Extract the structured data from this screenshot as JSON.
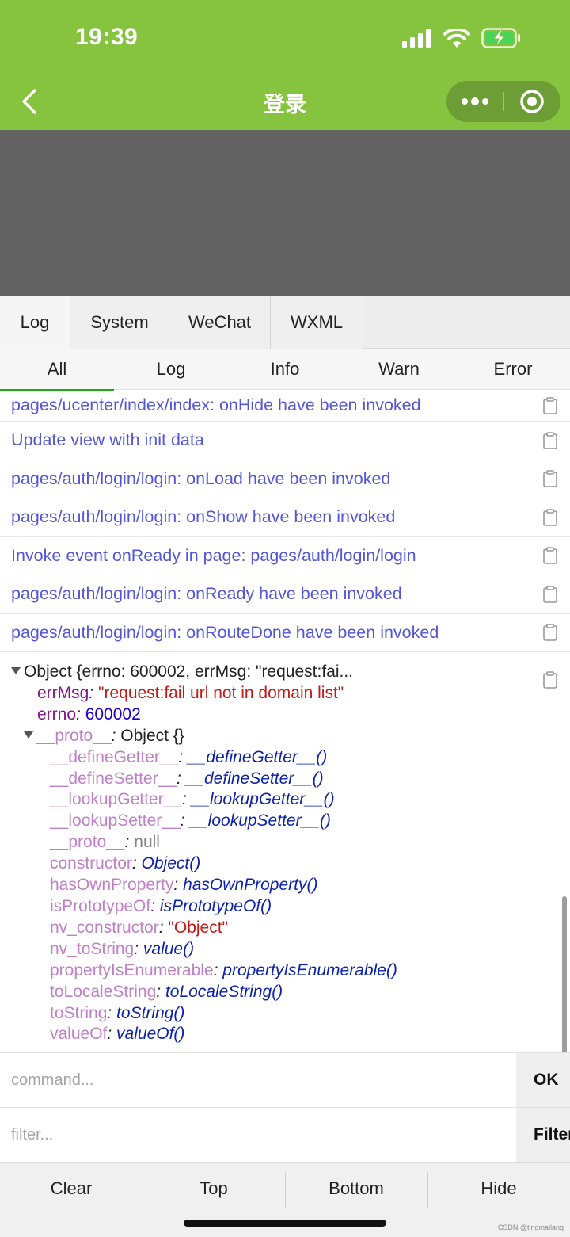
{
  "status_bar": {
    "time": "19:39"
  },
  "nav_bar": {
    "title": "登录"
  },
  "tabs": [
    {
      "label": "Log",
      "active": true
    },
    {
      "label": "System",
      "active": false
    },
    {
      "label": "WeChat",
      "active": false
    },
    {
      "label": "WXML",
      "active": false
    }
  ],
  "subtabs": [
    {
      "label": "All",
      "active": true
    },
    {
      "label": "Log",
      "active": false
    },
    {
      "label": "Info",
      "active": false
    },
    {
      "label": "Warn",
      "active": false
    },
    {
      "label": "Error",
      "active": false
    }
  ],
  "logs": [
    "pages/ucenter/index/index: onHide have been invoked",
    "Update view with init data",
    "pages/auth/login/login: onLoad have been invoked",
    "pages/auth/login/login: onShow have been invoked",
    "Invoke event onReady in page: pages/auth/login/login",
    "pages/auth/login/login: onReady have been invoked",
    "pages/auth/login/login: onRouteDone have been invoked"
  ],
  "object_entry": {
    "summary": "Object {errno: 600002, errMsg: \"request:fai...",
    "own_props": [
      {
        "key": "errMsg",
        "value": "\"request:fail url not in domain list\"",
        "type": "str"
      },
      {
        "key": "errno",
        "value": "600002",
        "type": "num"
      }
    ],
    "proto": {
      "key": "__proto__",
      "value": "Object {}"
    },
    "proto_props": [
      {
        "key": "__defineGetter__",
        "value": "__defineGetter__()",
        "type": "fn"
      },
      {
        "key": "__defineSetter__",
        "value": "__defineSetter__()",
        "type": "fn"
      },
      {
        "key": "__lookupGetter__",
        "value": "__lookupGetter__()",
        "type": "fn"
      },
      {
        "key": "__lookupSetter__",
        "value": "__lookupSetter__()",
        "type": "fn"
      },
      {
        "key": "__proto__",
        "value": "null",
        "type": "null"
      },
      {
        "key": "constructor",
        "value": "Object()",
        "type": "fn"
      },
      {
        "key": "hasOwnProperty",
        "value": "hasOwnProperty()",
        "type": "fn"
      },
      {
        "key": "isPrototypeOf",
        "value": "isPrototypeOf()",
        "type": "fn"
      },
      {
        "key": "nv_constructor",
        "value": "\"Object\"",
        "type": "str"
      },
      {
        "key": "nv_toString",
        "value": "value()",
        "type": "fn"
      },
      {
        "key": "propertyIsEnumerable",
        "value": "propertyIsEnumerable()",
        "type": "fn"
      },
      {
        "key": "toLocaleString",
        "value": "toLocaleString()",
        "type": "fn"
      },
      {
        "key": "toString",
        "value": "toString()",
        "type": "fn"
      },
      {
        "key": "valueOf",
        "value": "valueOf()",
        "type": "fn"
      }
    ]
  },
  "command": {
    "placeholder": "command...",
    "button": "OK"
  },
  "filter": {
    "placeholder": "filter...",
    "button": "Filter"
  },
  "toolbar": {
    "clear": "Clear",
    "top": "Top",
    "bottom": "Bottom",
    "hide": "Hide"
  },
  "watermark": "CSDN @tingmailang",
  "colors": {
    "nav_green": "#86c440",
    "log_text": "#5356d8",
    "grey_area": "#626262"
  },
  "icons": [
    "back-icon",
    "more-dots-icon",
    "close-target-icon",
    "copy-icon",
    "signal-icon",
    "wifi-icon",
    "battery-charging-icon"
  ]
}
